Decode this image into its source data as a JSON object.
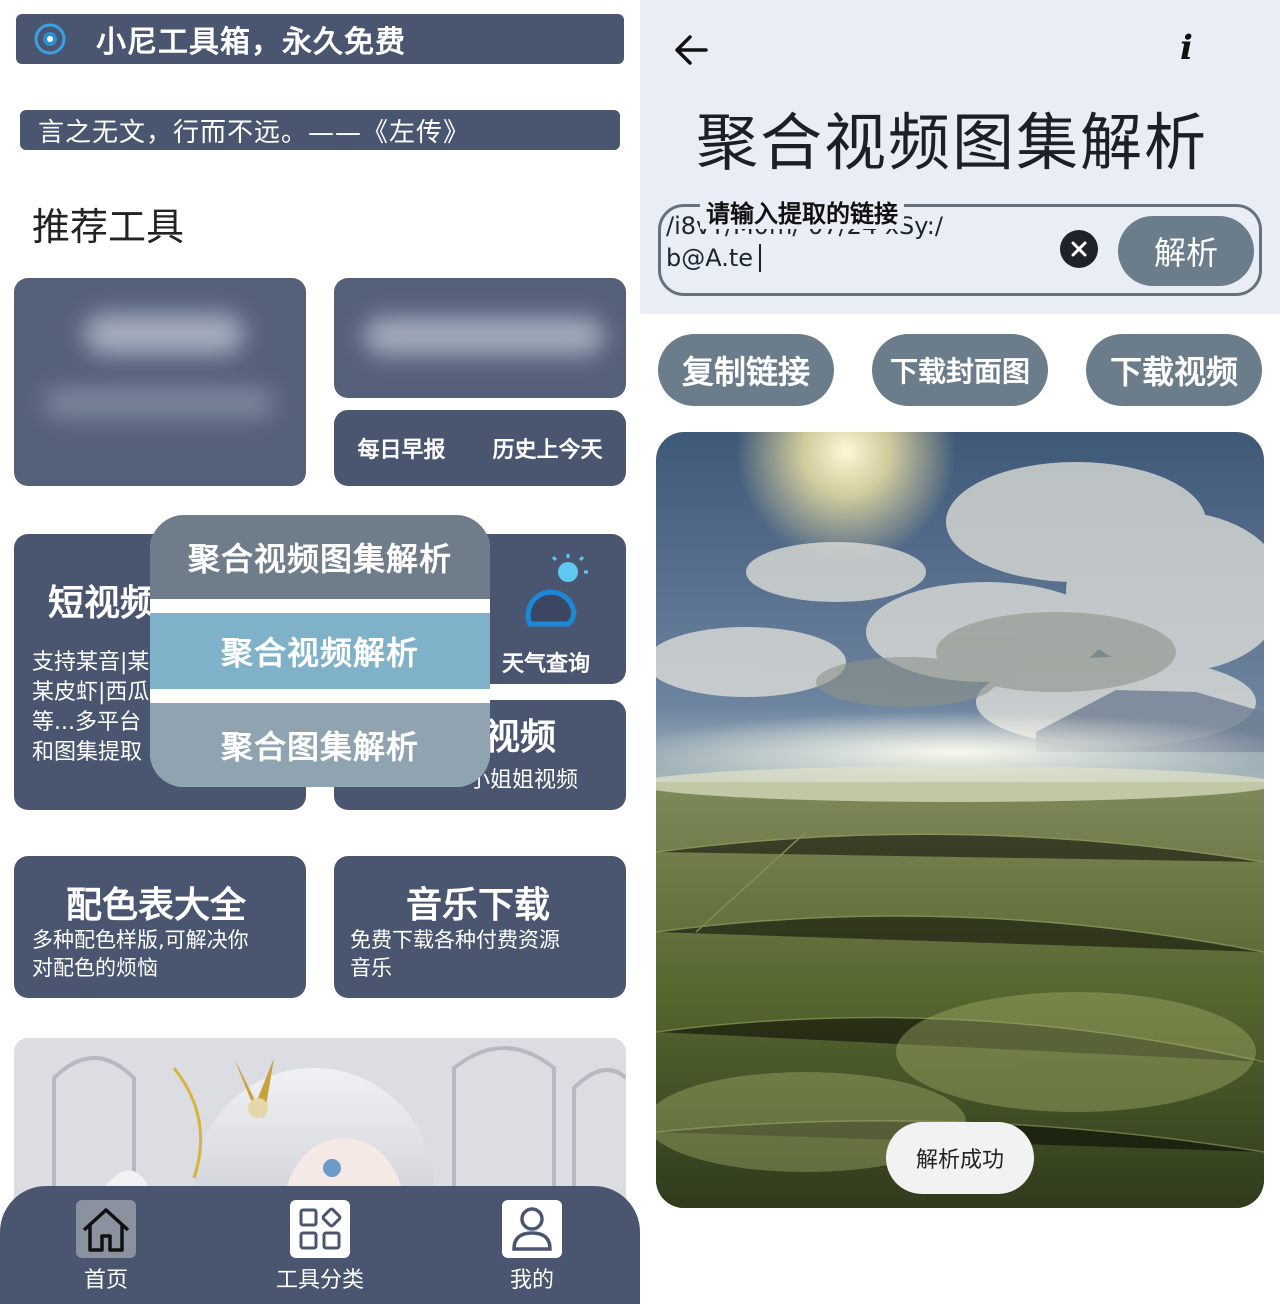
{
  "left": {
    "app_title": "小尼工具箱，永久免费",
    "quote": "言之无文，行而不远。——《左传》",
    "section_title": "推荐工具",
    "small_card": {
      "items": [
        "每日早报",
        "历史上今天"
      ]
    },
    "short_video": {
      "title": "短视频",
      "desc_lines": [
        "支持某音|某",
        "某皮虾|西瓜",
        "等...多平台",
        "和图集提取"
      ]
    },
    "weather": {
      "label": "天气查询"
    },
    "girl_video": {
      "title": "视频",
      "desc": "小姐姐视频"
    },
    "color_table": {
      "title": "配色表大全",
      "desc_lines": [
        "多种配色样版,可解决你",
        "对配色的烦恼"
      ]
    },
    "music": {
      "title": "音乐下载",
      "desc_lines": [
        "免费下载各种付费资源",
        "音乐"
      ]
    },
    "popup": {
      "items": [
        "聚合视频图集解析",
        "聚合视频解析",
        "聚合图集解析"
      ],
      "colors": [
        "#6f7d8a",
        "#7fb2c9",
        "#8fa3b0"
      ]
    },
    "nav": {
      "items": [
        {
          "label": "首页",
          "icon": "home-icon"
        },
        {
          "label": "工具分类",
          "icon": "grid-icon"
        },
        {
          "label": "我的",
          "icon": "user-icon"
        }
      ]
    }
  },
  "right": {
    "title": "聚合视频图集解析",
    "url_field": {
      "legend": "请输入提取的链接",
      "value_line1": "/i8vY/M0m/ 07/24 xSy:/",
      "value_line2": "b@A.te"
    },
    "parse_button": "解析",
    "actions": [
      "复制链接",
      "下载封面图",
      "下载视频"
    ],
    "toast": "解析成功"
  },
  "colors": {
    "navy": "#4a5670",
    "pill": "#6b7d8b",
    "panel_bg": "#e9eef6"
  }
}
